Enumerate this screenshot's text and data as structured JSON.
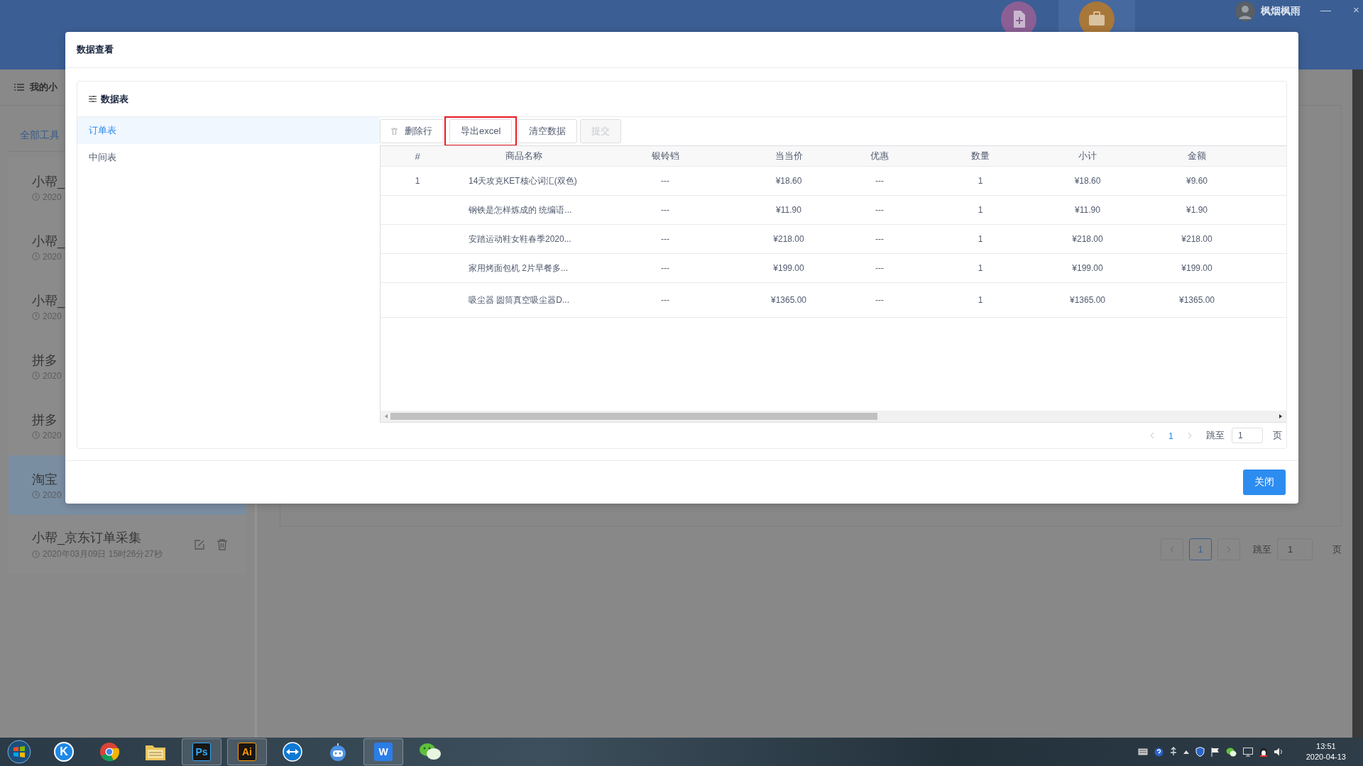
{
  "background_app": {
    "header": {
      "user_name": "枫烟枫雨",
      "minimize": "—",
      "close": "×"
    },
    "sidebar": {
      "title": "我的小",
      "tabs": [
        {
          "label": "全部工具",
          "selected": true
        }
      ],
      "items": [
        {
          "name": "小帮_",
          "time": "2020",
          "selected": false
        },
        {
          "name": "小帮_",
          "time": "2020",
          "selected": false
        },
        {
          "name": "小帮_",
          "time": "2020",
          "selected": false
        },
        {
          "name": "拼多",
          "time": "2020",
          "selected": false
        },
        {
          "name": "拼多",
          "time": "2020",
          "selected": false
        },
        {
          "name": "淘宝",
          "time": "2020",
          "selected": true
        },
        {
          "name": "小帮_京东订单采集",
          "time": "2020年03月09日 15时26分27秒",
          "selected": false
        }
      ]
    },
    "pagination": {
      "page": "1",
      "jump_label": "跳至",
      "jump_value": "1",
      "page_suffix": "页"
    }
  },
  "dialog": {
    "title": "数据查看",
    "card_title": "数据表",
    "tables": [
      {
        "label": "订单表",
        "selected": true
      },
      {
        "label": "中间表",
        "selected": false
      }
    ],
    "toolbar": [
      {
        "label": "删除行",
        "kind": "with-icon",
        "disabled": false,
        "highlighted": false
      },
      {
        "label": "导出excel",
        "kind": "plain",
        "disabled": false,
        "highlighted": true
      },
      {
        "label": "清空数据",
        "kind": "plain",
        "disabled": false,
        "highlighted": false
      },
      {
        "label": "提交",
        "kind": "plain",
        "disabled": true,
        "highlighted": false
      }
    ],
    "columns": [
      "#",
      "商品名称",
      "银铃铛",
      "当当价",
      "优惠",
      "数量",
      "小计",
      "金额"
    ],
    "rows": [
      [
        "1",
        "14天攻克KET核心词汇(双色)",
        "---",
        "¥18.60",
        "---",
        "1",
        "¥18.60",
        "¥9.60"
      ],
      [
        "",
        "钢铁是怎样炼成的 统编语...",
        "---",
        "¥11.90",
        "---",
        "1",
        "¥11.90",
        "¥1.90"
      ],
      [
        "",
        "安踏运动鞋女鞋春季2020...",
        "---",
        "¥218.00",
        "---",
        "1",
        "¥218.00",
        "¥218.00"
      ],
      [
        "",
        "家用烤面包机 2片早餐多...",
        "---",
        "¥199.00",
        "---",
        "1",
        "¥199.00",
        "¥199.00"
      ],
      [
        "",
        "吸尘器 圆筒真空吸尘器D...",
        "---",
        "¥1365.00",
        "---",
        "1",
        "¥1365.00",
        "¥1365.00"
      ]
    ],
    "pagination": {
      "page": "1",
      "jump_label": "跳至",
      "jump_value": "1",
      "page_suffix": "页"
    },
    "close_button": "关闭"
  },
  "taskbar": {
    "apps": [
      {
        "kind": "start"
      },
      {
        "kind": "letter-round",
        "label": "K",
        "color": "#1e88e5"
      },
      {
        "kind": "browser"
      },
      {
        "kind": "folder"
      },
      {
        "kind": "letter-dark",
        "label": "Ps",
        "color": "#31a8ff"
      },
      {
        "kind": "letter-dark",
        "label": "Ai",
        "color": "#ff9a00"
      },
      {
        "kind": "remote"
      },
      {
        "kind": "robot"
      },
      {
        "kind": "letter-filled",
        "label": "W",
        "color": "#2b7de9"
      },
      {
        "kind": "chat"
      }
    ],
    "time": "13:51",
    "date": "2020-04-13"
  }
}
